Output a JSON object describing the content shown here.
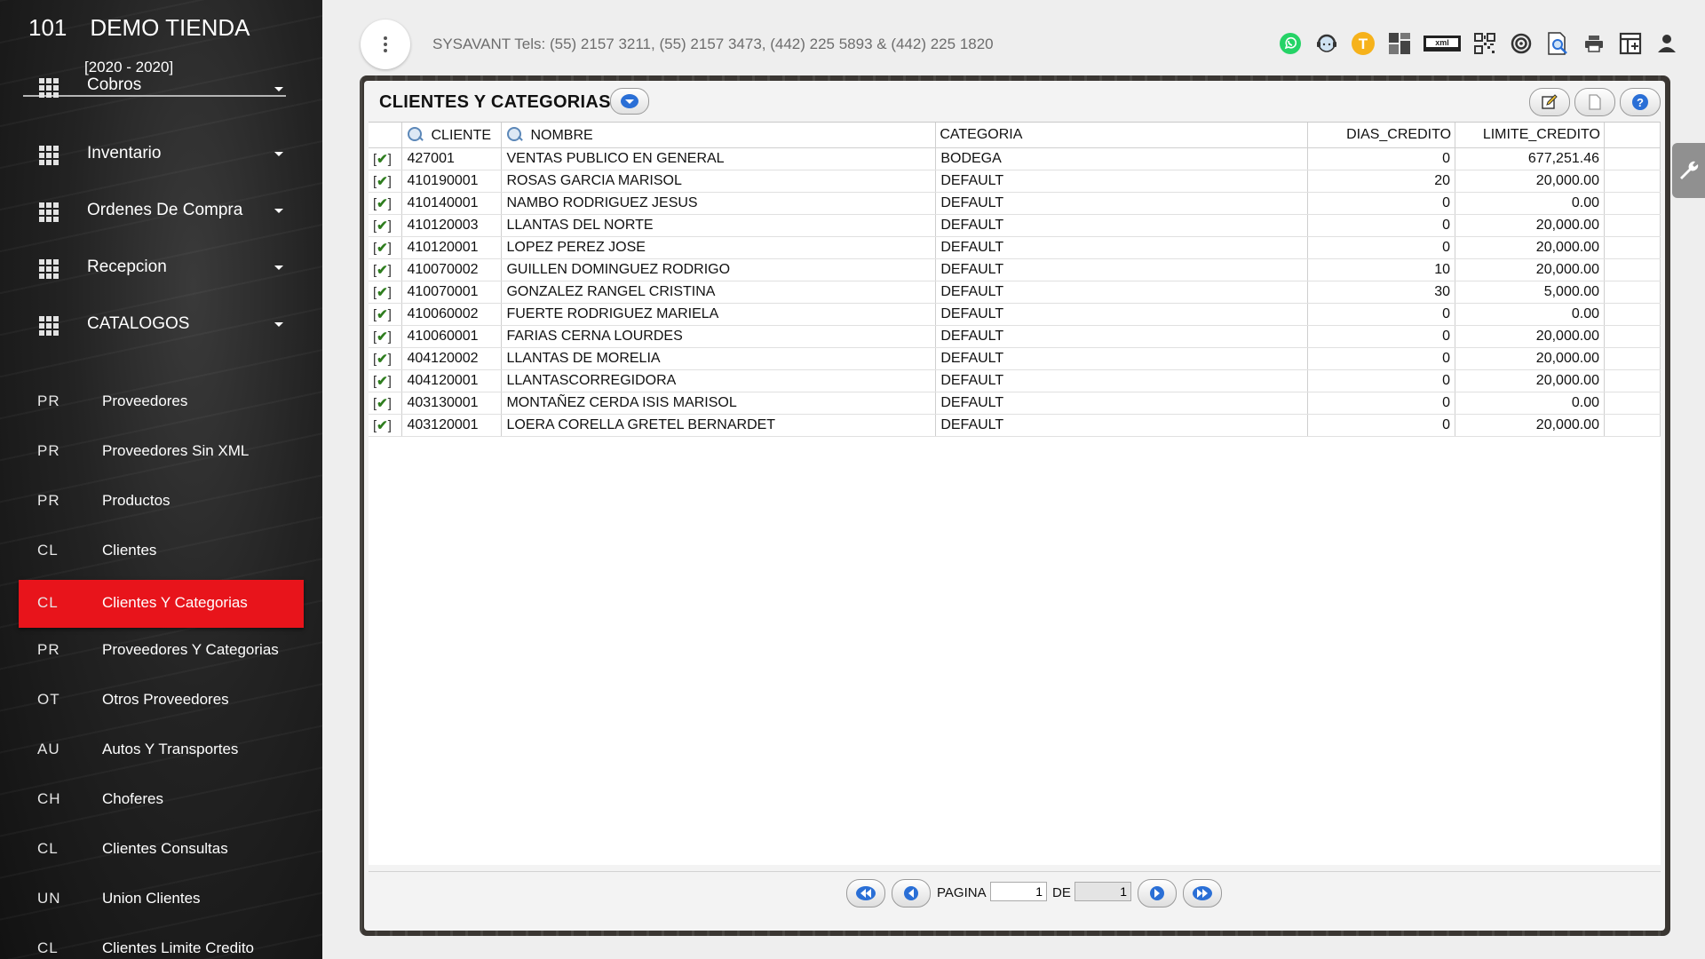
{
  "sidebar": {
    "company_code": "101",
    "company_name": "DEMO TIENDA",
    "years": "[2020 - 2020]",
    "menus": [
      {
        "label": "Cobros"
      },
      {
        "label": "Inventario"
      },
      {
        "label": "Ordenes De Compra"
      },
      {
        "label": "Recepcion"
      },
      {
        "label": "CATALOGOS"
      }
    ],
    "subitems": [
      {
        "abbr": "PR",
        "label": "Proveedores"
      },
      {
        "abbr": "PR",
        "label": "Proveedores Sin XML"
      },
      {
        "abbr": "PR",
        "label": "Productos"
      },
      {
        "abbr": "CL",
        "label": "Clientes"
      },
      {
        "abbr": "CL",
        "label": "Clientes Y Categorias"
      },
      {
        "abbr": "PR",
        "label": "Proveedores Y Categorias"
      },
      {
        "abbr": "OT",
        "label": "Otros Proveedores"
      },
      {
        "abbr": "AU",
        "label": "Autos Y Transportes"
      },
      {
        "abbr": "CH",
        "label": "Choferes"
      },
      {
        "abbr": "CL",
        "label": "Clientes Consultas"
      },
      {
        "abbr": "UN",
        "label": "Union Clientes"
      },
      {
        "abbr": "CL",
        "label": "Clientes Limite Credito"
      }
    ]
  },
  "topbar": {
    "info": "SYSAVANT Tels: (55) 2157 3211, (55) 2157 3473, (442) 225 5893 & (442) 225 1820",
    "icons": [
      "whatsapp-icon",
      "support-agent-icon",
      "t-badge-icon",
      "dashboard-icon",
      "xml-icon",
      "qr-code-icon",
      "target-icon",
      "search-document-icon",
      "printer-icon",
      "add-window-icon",
      "user-icon"
    ],
    "t_badge": "T",
    "xml_label": "xml"
  },
  "window": {
    "title": "CLIENTES Y CATEGORIAS",
    "columns": {
      "cliente": "CLIENTE",
      "nombre": "NOMBRE",
      "categoria": "CATEGORIA",
      "dias": "DIAS_CREDITO",
      "limite": "LIMITE_CREDITO"
    },
    "rows": [
      {
        "cliente": "427001",
        "nombre": "VENTAS PUBLICO EN GENERAL",
        "categoria": "BODEGA",
        "dias": "0",
        "limite": "677,251.46"
      },
      {
        "cliente": "410190001",
        "nombre": "ROSAS GARCIA MARISOL",
        "categoria": "DEFAULT",
        "dias": "20",
        "limite": "20,000.00"
      },
      {
        "cliente": "410140001",
        "nombre": "NAMBO RODRIGUEZ JESUS",
        "categoria": "DEFAULT",
        "dias": "0",
        "limite": "0.00"
      },
      {
        "cliente": "410120003",
        "nombre": "LLANTAS DEL NORTE",
        "categoria": "DEFAULT",
        "dias": "0",
        "limite": "20,000.00"
      },
      {
        "cliente": "410120001",
        "nombre": "LOPEZ PEREZ JOSE",
        "categoria": "DEFAULT",
        "dias": "0",
        "limite": "20,000.00"
      },
      {
        "cliente": "410070002",
        "nombre": "GUILLEN DOMINGUEZ RODRIGO",
        "categoria": "DEFAULT",
        "dias": "10",
        "limite": "20,000.00"
      },
      {
        "cliente": "410070001",
        "nombre": "GONZALEZ RANGEL CRISTINA",
        "categoria": "DEFAULT",
        "dias": "30",
        "limite": "5,000.00"
      },
      {
        "cliente": "410060002",
        "nombre": "FUERTE RODRIGUEZ MARIELA",
        "categoria": "DEFAULT",
        "dias": "0",
        "limite": "0.00"
      },
      {
        "cliente": "410060001",
        "nombre": "FARIAS CERNA LOURDES",
        "categoria": "DEFAULT",
        "dias": "0",
        "limite": "20,000.00"
      },
      {
        "cliente": "404120002",
        "nombre": "LLANTAS DE MORELIA",
        "categoria": "DEFAULT",
        "dias": "0",
        "limite": "20,000.00"
      },
      {
        "cliente": "404120001",
        "nombre": "LLANTASCORREGIDORA",
        "categoria": "DEFAULT",
        "dias": "0",
        "limite": "20,000.00"
      },
      {
        "cliente": "403130001",
        "nombre": "MONTAÑEZ CERDA ISIS MARISOL",
        "categoria": "DEFAULT",
        "dias": "0",
        "limite": "0.00"
      },
      {
        "cliente": "403120001",
        "nombre": "LOERA CORELLA GRETEL BERNARDET",
        "categoria": "DEFAULT",
        "dias": "0",
        "limite": "20,000.00"
      }
    ],
    "pager": {
      "pagina_label": "PAGINA",
      "page": "1",
      "de_label": "DE",
      "total": "1"
    }
  },
  "colors": {
    "active_item": "#e8141b",
    "check": "#2e7d1e",
    "blue_icon": "#2a6fd6"
  }
}
